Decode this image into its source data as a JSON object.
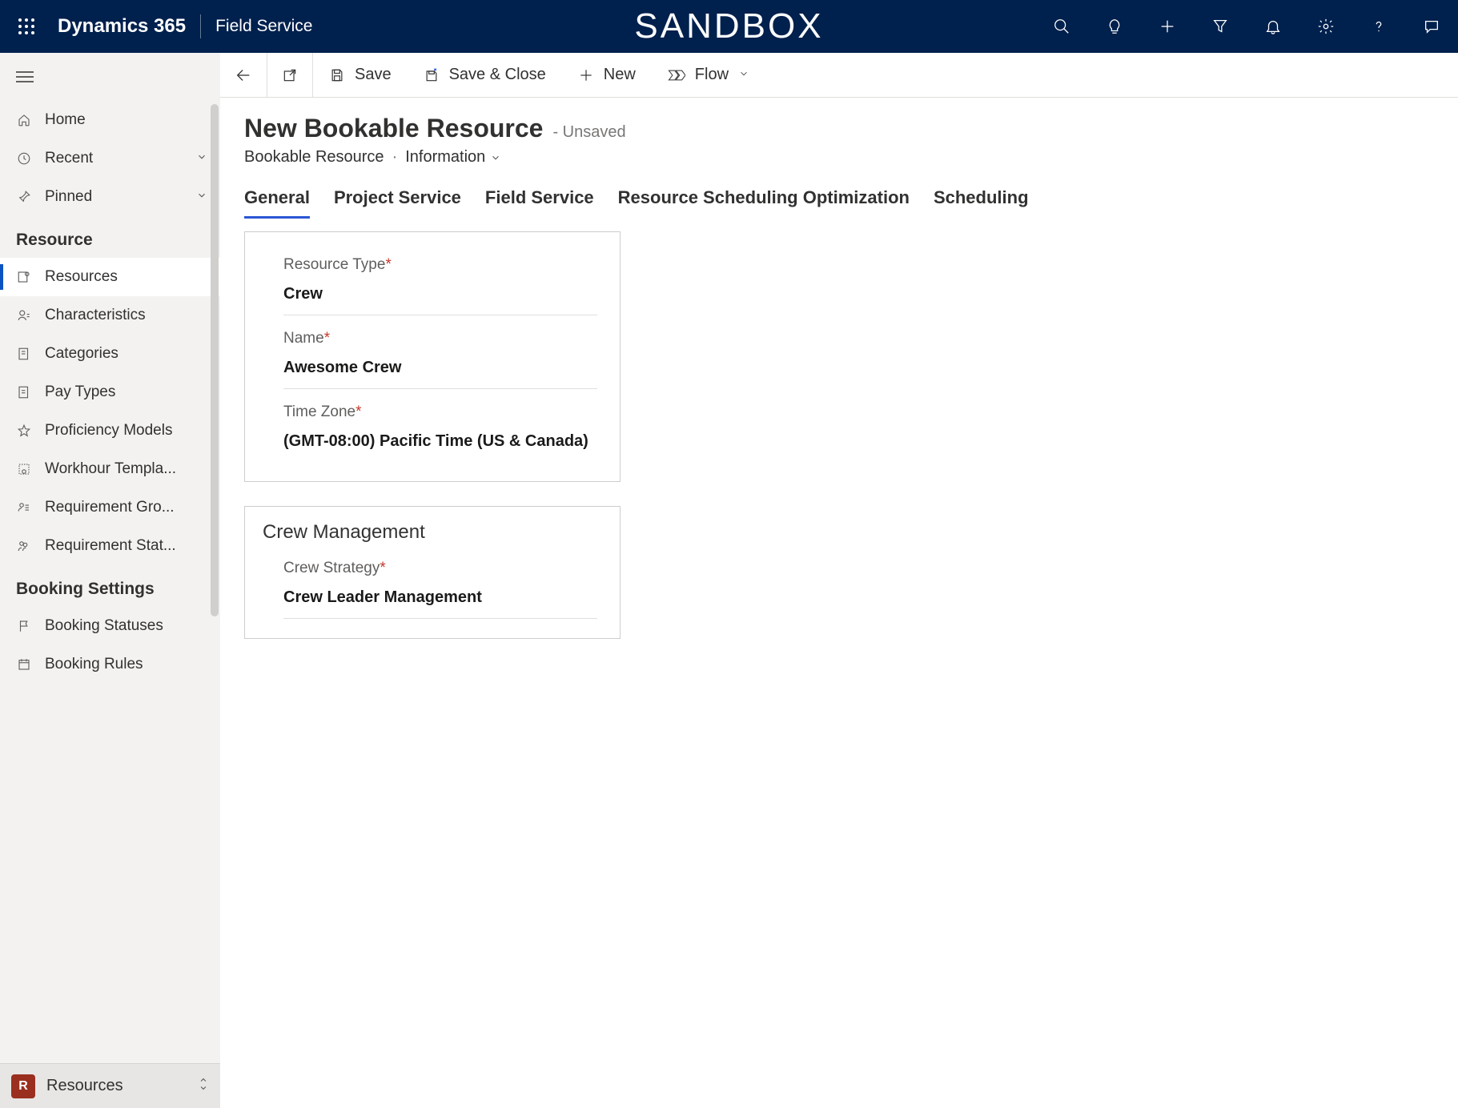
{
  "topbar": {
    "brand": "Dynamics 365",
    "app": "Field Service",
    "center": "SANDBOX"
  },
  "sidebar": {
    "home": "Home",
    "recent": "Recent",
    "pinned": "Pinned",
    "sections": {
      "resource_title": "Resource",
      "booking_title": "Booking Settings"
    },
    "resource_items": [
      "Resources",
      "Characteristics",
      "Categories",
      "Pay Types",
      "Proficiency Models",
      "Workhour Templa...",
      "Requirement Gro...",
      "Requirement Stat..."
    ],
    "booking_items": [
      "Booking Statuses",
      "Booking Rules"
    ],
    "footer": {
      "badge": "R",
      "label": "Resources"
    }
  },
  "commandbar": {
    "save": "Save",
    "save_close": "Save & Close",
    "new": "New",
    "flow": "Flow"
  },
  "page": {
    "title": "New Bookable Resource",
    "status": "- Unsaved",
    "entity": "Bookable Resource",
    "form": "Information"
  },
  "tabs": [
    "General",
    "Project Service",
    "Field Service",
    "Resource Scheduling Optimization",
    "Scheduling"
  ],
  "form": {
    "resource_type_label": "Resource Type",
    "resource_type_value": "Crew",
    "name_label": "Name",
    "name_value": "Awesome Crew",
    "timezone_label": "Time Zone",
    "timezone_value": "(GMT-08:00) Pacific Time (US & Canada)",
    "crew_mgmt_title": "Crew Management",
    "crew_strategy_label": "Crew Strategy",
    "crew_strategy_value": "Crew Leader Management"
  }
}
